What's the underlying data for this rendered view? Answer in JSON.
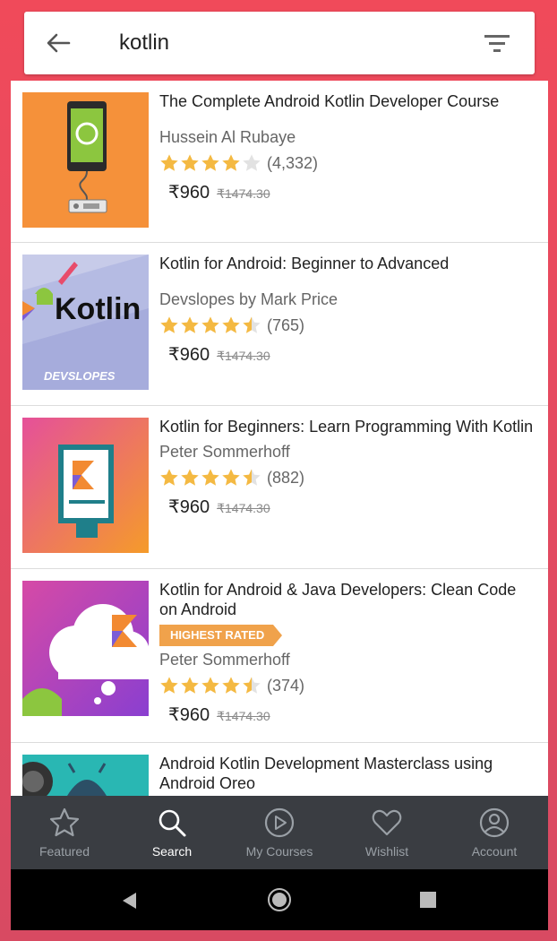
{
  "search": {
    "query": "kotlin"
  },
  "courses": [
    {
      "title": "The Complete Android Kotlin Developer Course",
      "author": "Hussein Al Rubaye",
      "rating": 4.0,
      "count": "(4,332)",
      "price": "₹960",
      "original_price": "₹1474.30",
      "badge": ""
    },
    {
      "title": "Kotlin for Android: Beginner to Advanced",
      "author": "Devslopes by Mark Price",
      "rating": 4.5,
      "count": "(765)",
      "price": "₹960",
      "original_price": "₹1474.30",
      "badge": "",
      "thumb_text": "Kotlin",
      "thumb_subtext": "DEVSLOPES"
    },
    {
      "title": "Kotlin for Beginners: Learn Programming With Kotlin",
      "author": "Peter Sommerhoff",
      "rating": 4.5,
      "count": "(882)",
      "price": "₹960",
      "original_price": "₹1474.30",
      "badge": ""
    },
    {
      "title": "Kotlin for Android & Java Developers: Clean Code on Android",
      "author": "Peter Sommerhoff",
      "rating": 4.5,
      "count": "(374)",
      "price": "₹960",
      "original_price": "₹1474.30",
      "badge": "HIGHEST RATED"
    },
    {
      "title": "Android Kotlin Development Masterclass using Android Oreo"
    }
  ],
  "nav": {
    "featured": "Featured",
    "search": "Search",
    "my_courses": "My Courses",
    "wishlist": "Wishlist",
    "account": "Account"
  },
  "colors": {
    "star": "#f4b942",
    "badge": "#f0a24b",
    "nav_bg": "#3a3d42"
  }
}
